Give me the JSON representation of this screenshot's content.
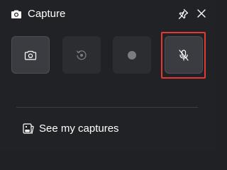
{
  "window": {
    "title": "Capture"
  },
  "capture_buttons": [
    {
      "icon": "camera-icon",
      "state": "active"
    },
    {
      "icon": "replay-icon",
      "state": "disabled"
    },
    {
      "icon": "record-icon",
      "state": "disabled"
    },
    {
      "icon": "microphone-off-icon",
      "state": "highlighted"
    }
  ],
  "footer": {
    "captures_label": "See my captures"
  },
  "colors": {
    "background": "#212225",
    "tile_active": "#3a3c42",
    "tile_disabled": "#2c2d30",
    "highlight": "#e53935",
    "text": "#ffffff"
  }
}
